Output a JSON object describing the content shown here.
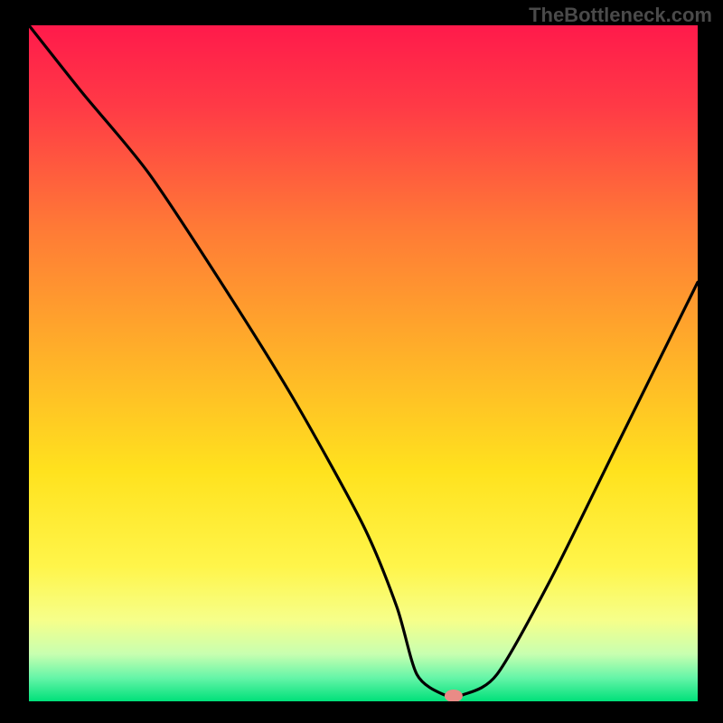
{
  "watermark": "TheBottleneck.com",
  "chart_data": {
    "type": "line",
    "title": "",
    "xlabel": "",
    "ylabel": "",
    "xlim": [
      0,
      100
    ],
    "ylim": [
      0,
      100
    ],
    "series": [
      {
        "name": "bottleneck-curve",
        "x": [
          0,
          8,
          18,
          30,
          40,
          50,
          55,
          58,
          62,
          65,
          70,
          78,
          88,
          100
        ],
        "y": [
          100,
          90,
          78,
          60,
          44,
          26,
          14,
          4,
          1,
          1,
          4,
          18,
          38,
          62
        ]
      }
    ],
    "marker": {
      "x": 63.5,
      "y": 0.8
    },
    "gradient_stops": [
      {
        "offset": 0.0,
        "color": "#ff1a4b"
      },
      {
        "offset": 0.12,
        "color": "#ff3a46"
      },
      {
        "offset": 0.3,
        "color": "#ff7a36"
      },
      {
        "offset": 0.5,
        "color": "#ffb428"
      },
      {
        "offset": 0.66,
        "color": "#ffe21e"
      },
      {
        "offset": 0.8,
        "color": "#fff54a"
      },
      {
        "offset": 0.88,
        "color": "#f6ff8a"
      },
      {
        "offset": 0.93,
        "color": "#c8ffb0"
      },
      {
        "offset": 0.965,
        "color": "#66f5a8"
      },
      {
        "offset": 1.0,
        "color": "#00e07a"
      }
    ],
    "marker_color": "#e98b86",
    "curve_color": "#000000"
  }
}
